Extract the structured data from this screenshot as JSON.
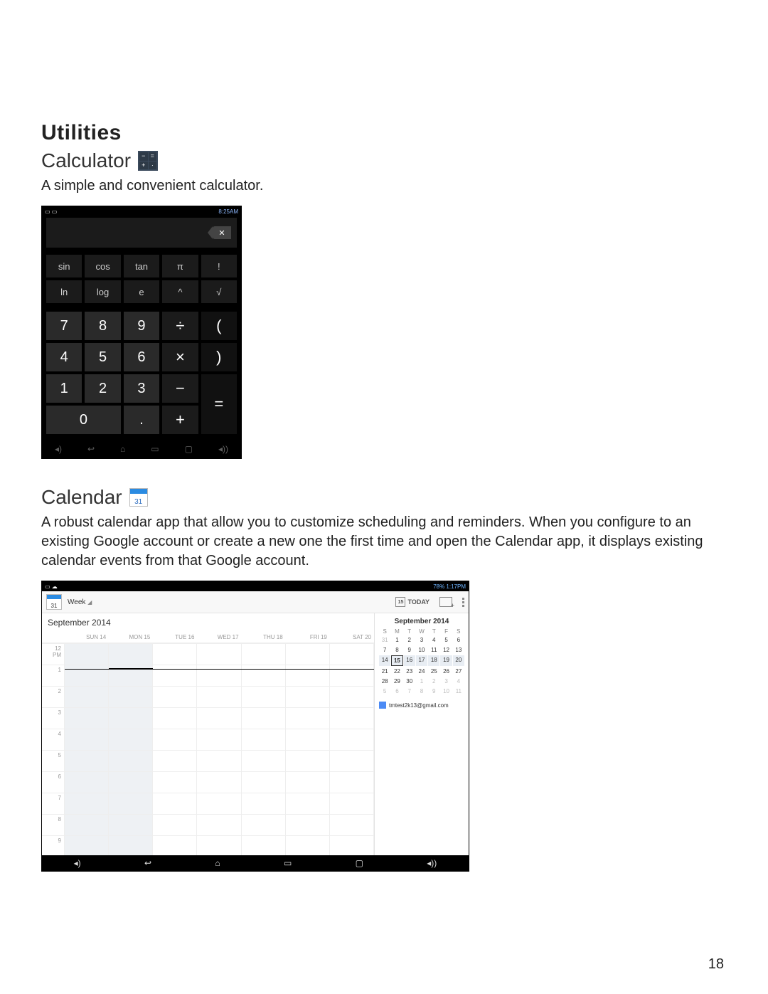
{
  "page_number": "18",
  "section_heading": "Utilities",
  "calculator": {
    "title": "Calculator",
    "description": "A simple and convenient calculator.",
    "status_right": "8:25AM",
    "scientific": [
      "sin",
      "cos",
      "tan",
      "π",
      "!",
      "ln",
      "log",
      "e",
      "^",
      "√"
    ],
    "keys": {
      "k7": "7",
      "k8": "8",
      "k9": "9",
      "div": "÷",
      "lpar": "(",
      "k4": "4",
      "k5": "5",
      "k6": "6",
      "mul": "×",
      "rpar": ")",
      "k1": "1",
      "k2": "2",
      "k3": "3",
      "sub": "−",
      "eq": "=",
      "k0": "0",
      "dot": ".",
      "add": "+"
    }
  },
  "calendar": {
    "title": "Calendar",
    "icon_day": "31",
    "description": "A robust calendar app that allow you to customize scheduling and reminders. When you configure to an existing Google account or create a new one the first time and open the Calendar app, it displays existing calendar events from that Google account.",
    "status_right": "78% 1:17PM",
    "view_label": "Week",
    "today_label": "TODAY",
    "today_num": "15",
    "month_label": "September 2014",
    "day_headers": [
      "SUN 14",
      "MON 15",
      "TUE 16",
      "WED 17",
      "THU 18",
      "FRI 19",
      "SAT 20"
    ],
    "hours": [
      "12 PM",
      "1",
      "2",
      "3",
      "4",
      "5",
      "6",
      "7",
      "8",
      "9"
    ],
    "mini": {
      "title": "September 2014",
      "dow": [
        "S",
        "M",
        "T",
        "W",
        "T",
        "F",
        "S"
      ],
      "rows": [
        [
          {
            "n": "31",
            "mute": true
          },
          {
            "n": "1"
          },
          {
            "n": "2"
          },
          {
            "n": "3"
          },
          {
            "n": "4"
          },
          {
            "n": "5"
          },
          {
            "n": "6"
          }
        ],
        [
          {
            "n": "7"
          },
          {
            "n": "8"
          },
          {
            "n": "9"
          },
          {
            "n": "10"
          },
          {
            "n": "11"
          },
          {
            "n": "12"
          },
          {
            "n": "13"
          }
        ],
        [
          {
            "n": "14",
            "wk": true
          },
          {
            "n": "15",
            "wk": true,
            "today": true
          },
          {
            "n": "16",
            "wk": true
          },
          {
            "n": "17",
            "wk": true
          },
          {
            "n": "18",
            "wk": true
          },
          {
            "n": "19",
            "wk": true
          },
          {
            "n": "20",
            "wk": true
          }
        ],
        [
          {
            "n": "21"
          },
          {
            "n": "22"
          },
          {
            "n": "23"
          },
          {
            "n": "24"
          },
          {
            "n": "25"
          },
          {
            "n": "26"
          },
          {
            "n": "27"
          }
        ],
        [
          {
            "n": "28"
          },
          {
            "n": "29"
          },
          {
            "n": "30"
          },
          {
            "n": "1",
            "mute": true
          },
          {
            "n": "2",
            "mute": true
          },
          {
            "n": "3",
            "mute": true
          },
          {
            "n": "4",
            "mute": true
          }
        ],
        [
          {
            "n": "5",
            "mute": true
          },
          {
            "n": "6",
            "mute": true
          },
          {
            "n": "7",
            "mute": true
          },
          {
            "n": "8",
            "mute": true
          },
          {
            "n": "9",
            "mute": true
          },
          {
            "n": "10",
            "mute": true
          },
          {
            "n": "11",
            "mute": true
          }
        ]
      ]
    },
    "account": "tmtest2k13@gmail.com"
  }
}
